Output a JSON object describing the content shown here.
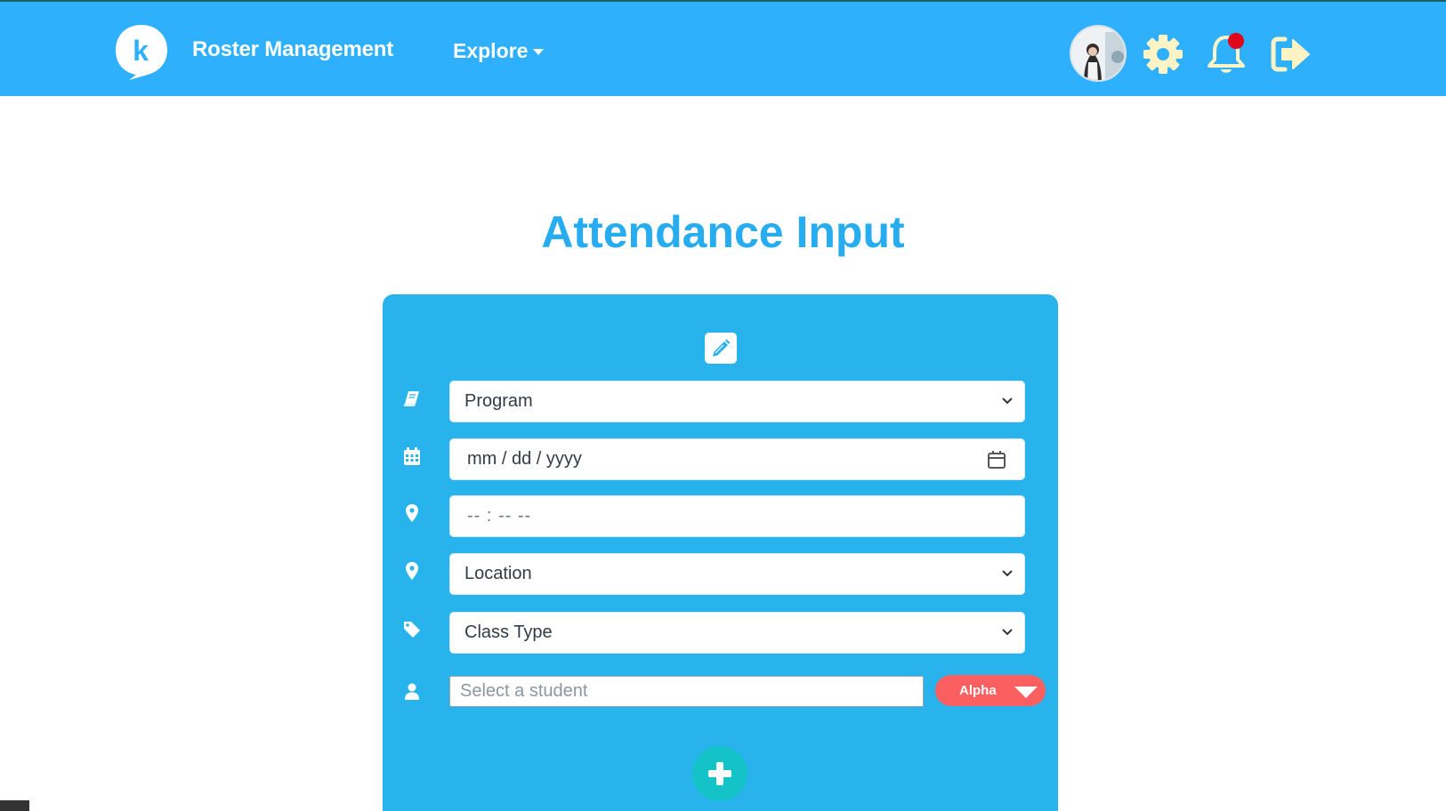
{
  "header": {
    "brand": "Roster Management",
    "explore_label": "Explore",
    "icons": {
      "logo": "speech-bubble-k-logo",
      "avatar": "user-avatar",
      "settings": "gear-icon",
      "notifications": "bell-icon",
      "logout": "sign-out-icon"
    },
    "colors": {
      "bar": "#2fb0fc",
      "icons": "#fdf3c4",
      "notification_dot": "#e0061b"
    }
  },
  "page": {
    "title": "Attendance Input"
  },
  "form": {
    "program": {
      "value": "Program",
      "icon": "book-icon"
    },
    "date": {
      "value": "mm / dd / yyyy",
      "icon": "calendar-icon"
    },
    "time": {
      "value": "-- : --  --",
      "icon": "map-marker-icon"
    },
    "location": {
      "value": "Location",
      "icon": "map-marker-icon"
    },
    "class_type": {
      "value": "Class Type",
      "icon": "tag-icon"
    },
    "student": {
      "placeholder": "Select a student",
      "icon": "user-icon"
    },
    "sort_label": "Alpha",
    "colors": {
      "card": "#29b3ec",
      "sort_button": "#fc5f5f",
      "add_button": "#14c3c7"
    }
  }
}
